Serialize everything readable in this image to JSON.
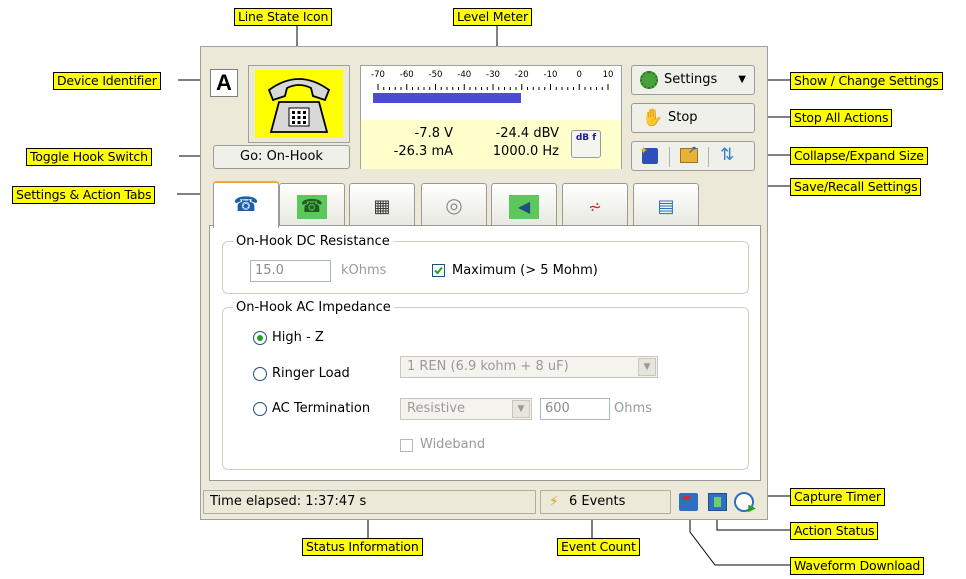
{
  "device": {
    "identifier": "A",
    "hook_button_label": "Go: On-Hook"
  },
  "meter": {
    "scale_labels": [
      "-70",
      "-60",
      "-50",
      "-40",
      "-30",
      "-20",
      "-10",
      "0",
      "10"
    ],
    "level_fraction": 0.63,
    "voltage": "-7.8  V",
    "current": "-26.3 mA",
    "level_dbv": "-24.4 dBV",
    "frequency": "1000.0 Hz",
    "unit_toggle_label": "dB f"
  },
  "toolbar": {
    "settings_label": "Settings",
    "stop_label": "Stop"
  },
  "tabs": [
    {
      "icon": "phone-blue-icon"
    },
    {
      "icon": "phone-green-icon"
    },
    {
      "icon": "keypad-icon"
    },
    {
      "icon": "dial-icon"
    },
    {
      "icon": "speaker-icon"
    },
    {
      "icon": "analyzer-icon"
    },
    {
      "icon": "grid-icon"
    }
  ],
  "dc_group": {
    "legend": "On-Hook DC Resistance",
    "value": "15.0",
    "unit": "kOhms",
    "max_label": "Maximum (> 5 Mohm)",
    "max_checked": true
  },
  "ac_group": {
    "legend": "On-Hook AC Impedance",
    "high_z_label": "High - Z",
    "ringer_label": "Ringer Load",
    "ringer_value": "1 REN (6.9 kohm + 8 uF)",
    "ac_term_label": "AC Termination",
    "ac_term_value": "Resistive",
    "ac_ohms_value": "600",
    "ohms_unit": "Ohms",
    "wideband_label": "Wideband"
  },
  "status": {
    "elapsed": "Time elapsed:  1:37:47 s",
    "events": "6 Events"
  },
  "callouts": {
    "line_state_icon": "Line State Icon",
    "level_meter": "Level Meter",
    "device_identifier": "Device Identifier",
    "show_change_settings": "Show / Change Settings",
    "stop_all_actions": "Stop All Actions",
    "toggle_hook_switch": "Toggle Hook Switch",
    "collapse_expand_size": "Collapse/Expand Size",
    "settings_action_tabs": "Settings & Action Tabs",
    "save_recall_settings": "Save/Recall Settings",
    "capture_timer": "Capture Timer",
    "action_status": "Action Status",
    "status_information": "Status Information",
    "event_count": "Event Count",
    "waveform_download": "Waveform Download"
  },
  "colors": {
    "accent_yellow": "#ffff00",
    "meter_bar": "#4b4bd8",
    "window_bg": "#ece9d8",
    "radio_dot": "#21a121"
  }
}
